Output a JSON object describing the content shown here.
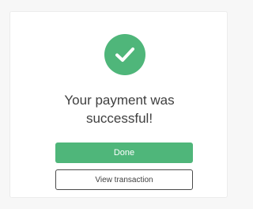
{
  "dialog": {
    "icon": "check-circle-icon",
    "message_line1": "Your payment was",
    "message_line2": "successful!",
    "primary_button": "Done",
    "secondary_button": "View transaction"
  },
  "colors": {
    "accent": "#4fb67a",
    "text": "#3f3f3f",
    "border": "#4a4a4a"
  }
}
